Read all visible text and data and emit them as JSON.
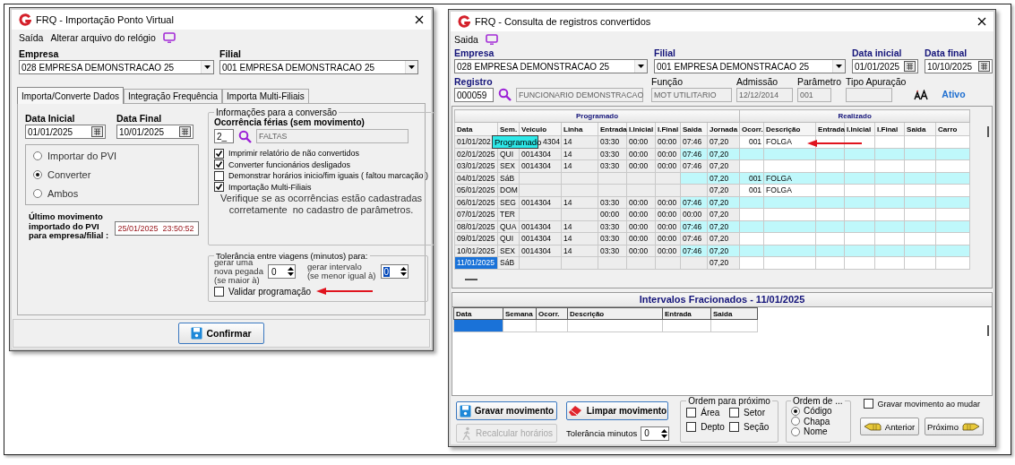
{
  "import_window": {
    "title": "FRQ - Importação Ponto Virtual",
    "menu": [
      "Saída",
      "Alterar arquivo do relógio"
    ],
    "empresa": {
      "label": "Empresa",
      "value": "028 EMPRESA DEMONSTRACAO 25"
    },
    "filial": {
      "label": "Filial",
      "value": "001 EMPRESA DEMONSTRACAO 25"
    },
    "tabs": [
      {
        "label": "Importa/Converte Dados",
        "selected": true
      },
      {
        "label": "Integração Frequência",
        "selected": false
      },
      {
        "label": "Importa Multi-Filiais",
        "selected": false
      }
    ],
    "data_inicial": {
      "label": "Data Inicial",
      "value": "01/01/2025"
    },
    "data_final": {
      "label": "Data Final",
      "value": "10/01/2025"
    },
    "modes": [
      {
        "label": "Importar do PVI",
        "selected": false
      },
      {
        "label": "Converter",
        "selected": true
      },
      {
        "label": "Ambos",
        "selected": false
      }
    ],
    "last_import": {
      "label": "Último movimento\nimportado do PVI\npara empresa/filial :",
      "value": "25/01/2025  23:50:52"
    },
    "conversion": {
      "title": "Informações para a conversão",
      "ocorrencia_label": "Ocorrência férias (sem movimento)",
      "ocorrencia_code": "2_",
      "ocorrencia_desc": "FALTAS",
      "options": [
        {
          "label": "Imprimir relatório de não convertidos",
          "checked": true
        },
        {
          "label": "Converter funcionários desligados",
          "checked": true
        },
        {
          "label": "Demonstrar horários inicio/fim iguais ( faltou marcação )",
          "checked": false
        },
        {
          "label": "Importação Multi-Filiais",
          "checked": true
        }
      ],
      "note": "Verifique se as ocorrências estão cadastradas\ncorretamente  no cadastro de parâmetros."
    },
    "tolerance": {
      "title": "Tolerância entre viagens (minutos) para:",
      "new_shift": {
        "label": "gerar uma\nnova pegada\n(se maior à)",
        "value": "0",
        "selected": false
      },
      "interval": {
        "label": "gerar intervalo\n(se menor igual à)",
        "value": "0",
        "selected": true
      },
      "validate": {
        "label": "Validar programação",
        "checked": false
      }
    },
    "confirm_button": "Confirmar"
  },
  "query_window": {
    "title": "FRQ - Consulta de registros convertidos",
    "menu": [
      "Saida"
    ],
    "empresa": {
      "label": "Empresa",
      "value": "028 EMPRESA DEMONSTRACAO 25"
    },
    "filial": {
      "label": "Filial",
      "value": "001 EMPRESA DEMONSTRACAO 25"
    },
    "data_inicial": {
      "label": "Data inicial",
      "value": "01/01/2025"
    },
    "data_final": {
      "label": "Data final",
      "value": "10/10/2025"
    },
    "registro": {
      "label": "Registro",
      "value": "000059",
      "name": "FUNCIONARIO DEMONSTRACAO"
    },
    "funcao": {
      "label": "Função",
      "value": "MOT UTILITARIO"
    },
    "admissao": {
      "label": "Admissão",
      "value": "12/12/2014"
    },
    "parametro": {
      "label": "Parâmetro",
      "value": "001"
    },
    "tipo_apuracao": {
      "label": "Tipo Apuração"
    },
    "status": "Ativo",
    "table": {
      "groups": [
        {
          "label": "Programado",
          "columns": [
            "Data",
            "Sem.",
            "Veiculo",
            "Linha",
            "Entrada",
            "I.Inicial",
            "I.Final",
            "Saida",
            "Jornada"
          ]
        },
        {
          "label": "Realizado",
          "columns": [
            "Ocorr.",
            "Descrição",
            "Entrada",
            "I.Inicial",
            "I.Final",
            "Saida",
            "Carro"
          ]
        }
      ],
      "rows": [
        {
          "cells": [
            "01/01/202",
            null,
            "4304",
            "14",
            "03:30",
            "00:00",
            "00:00",
            "07:46",
            "07,20",
            "001",
            "FOLGA",
            null,
            null,
            null,
            null,
            null
          ],
          "highlighted": false,
          "selected": false,
          "tooltip": "Programado"
        },
        {
          "cells": [
            "02/01/2025",
            "QUI",
            "0014304",
            "14",
            "03:30",
            "00:00",
            "00:00",
            "07:46",
            "07,20",
            null,
            null,
            null,
            null,
            null,
            null,
            null
          ],
          "highlighted": true,
          "selected": false
        },
        {
          "cells": [
            "03/01/2025",
            "SEX",
            "0014304",
            "14",
            "03:30",
            "00:00",
            "00:00",
            "07:46",
            "07,20",
            null,
            null,
            null,
            null,
            null,
            null,
            null
          ],
          "highlighted": false,
          "selected": false
        },
        {
          "cells": [
            "04/01/2025",
            "SáB",
            null,
            null,
            null,
            null,
            null,
            null,
            "07,20",
            "001",
            "FOLGA",
            null,
            null,
            null,
            null,
            null
          ],
          "highlighted": true,
          "selected": false
        },
        {
          "cells": [
            "05/01/2025",
            "DOM",
            null,
            null,
            null,
            null,
            null,
            null,
            "07,20",
            "001",
            "FOLGA",
            null,
            null,
            null,
            null,
            null
          ],
          "highlighted": false,
          "selected": false
        },
        {
          "cells": [
            "06/01/2025",
            "SEG",
            "0014304",
            "14",
            "03:30",
            "00:00",
            "00:00",
            "07:46",
            "07,20",
            null,
            null,
            null,
            null,
            null,
            null,
            null
          ],
          "highlighted": true,
          "selected": false
        },
        {
          "cells": [
            "07/01/2025",
            "TER",
            null,
            null,
            "00:00",
            "00:00",
            "00:00",
            "00:00",
            "07,20",
            null,
            null,
            null,
            null,
            null,
            null,
            null
          ],
          "highlighted": false,
          "selected": false
        },
        {
          "cells": [
            "08/01/2025",
            "QUA",
            "0014304",
            "14",
            "03:30",
            "00:00",
            "00:00",
            "07:46",
            "07,20",
            null,
            null,
            null,
            null,
            null,
            null,
            null
          ],
          "highlighted": true,
          "selected": false
        },
        {
          "cells": [
            "09/01/2025",
            "QUI",
            "0014304",
            "14",
            "03:30",
            "00:00",
            "00:00",
            "07:46",
            "07,20",
            null,
            null,
            null,
            null,
            null,
            null,
            null
          ],
          "highlighted": false,
          "selected": false
        },
        {
          "cells": [
            "10/01/2025",
            "SEX",
            "0014304",
            "14",
            "03:30",
            "00:00",
            "00:00",
            "07:46",
            "07,20",
            null,
            null,
            null,
            null,
            null,
            null,
            null
          ],
          "highlighted": true,
          "selected": false
        },
        {
          "cells": [
            "11/01/2025",
            "SáB",
            null,
            null,
            null,
            null,
            null,
            null,
            "07,20",
            null,
            null,
            null,
            null,
            null,
            null,
            null
          ],
          "highlighted": false,
          "selected": true
        }
      ]
    },
    "intervals": {
      "title": "Intervalos Fracionados - 11/01/2025",
      "columns": [
        "Data",
        "Semana",
        "Ocorr.",
        "Descrição",
        "Entrada",
        "Saida"
      ],
      "rows": [
        {
          "selected": true
        }
      ]
    },
    "buttons": {
      "save": "Gravar movimento",
      "clear": "Limpar movimento",
      "recalc": {
        "label": "Recalcular horários",
        "disabled": true
      }
    },
    "tolerance": {
      "label": "Tolerância minutos",
      "value": "0"
    },
    "order_next": {
      "title": "Ordem para próximo",
      "options": [
        {
          "label": "Área",
          "checked": false
        },
        {
          "label": "Setor",
          "checked": false
        },
        {
          "label": "Depto",
          "checked": false
        },
        {
          "label": "Seção",
          "checked": false
        }
      ]
    },
    "order_by": {
      "title": "Ordem de ...",
      "options": [
        {
          "label": "Código",
          "selected": true
        },
        {
          "label": "Chapa",
          "selected": false
        },
        {
          "label": "Nome",
          "selected": false
        }
      ]
    },
    "save_on_change": {
      "label": "Gravar movimento ao mudar",
      "checked": false
    },
    "nav": {
      "previous": "Anterior",
      "next": "Próximo"
    }
  }
}
